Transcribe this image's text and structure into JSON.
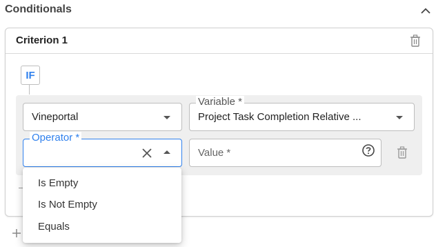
{
  "section": {
    "title": "Conditionals",
    "collapse_icon": "chevron-up-icon"
  },
  "criterion": {
    "title": "Criterion 1",
    "delete_icon": "trash-icon",
    "if_label": "IF"
  },
  "condition": {
    "source": {
      "value": "Vineportal"
    },
    "variable": {
      "label": "Variable *",
      "value": "Project Task Completion Relative ..."
    },
    "operator": {
      "label": "Operator *",
      "value": ""
    },
    "value_field": {
      "placeholder": "Value *",
      "help_icon": "help-circle-icon"
    }
  },
  "operator_menu": {
    "options": [
      "Is Empty",
      "Is Not Empty",
      "Equals"
    ]
  },
  "colors": {
    "accent": "#2f80ed",
    "border": "#bdbdbd",
    "group_bg": "#efefef"
  }
}
